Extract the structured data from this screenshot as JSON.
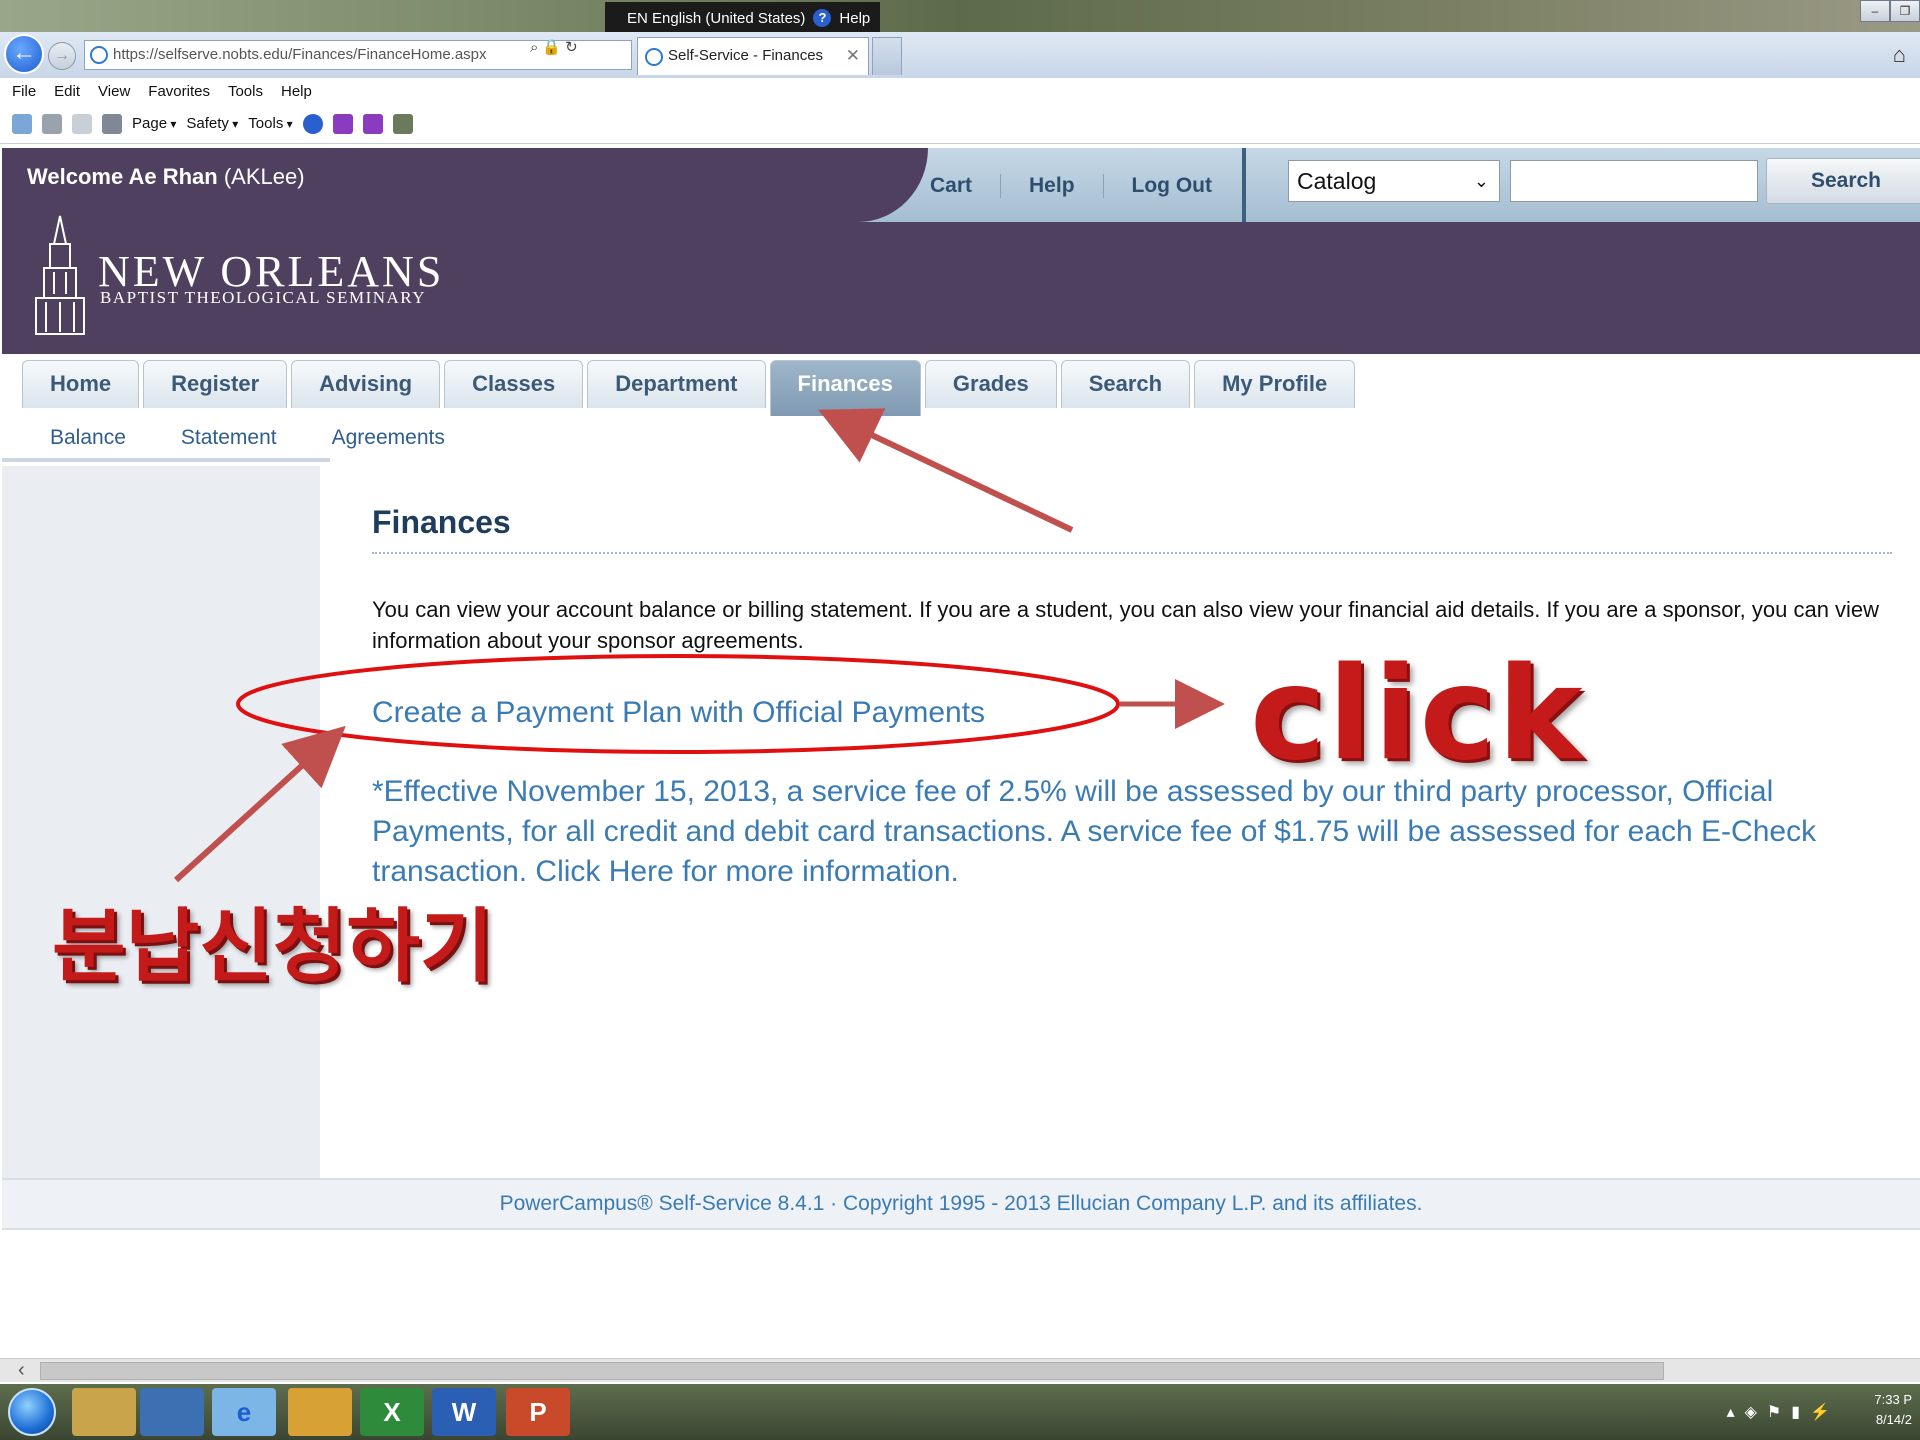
{
  "window": {
    "language_bar": "EN English (United States)",
    "language_help": "Help"
  },
  "browser": {
    "url": "https://selfserve.nobts.edu/Finances/FinanceHome.aspx",
    "tab_title": "Self-Service - Finances",
    "menu": [
      "File",
      "Edit",
      "View",
      "Favorites",
      "Tools",
      "Help"
    ],
    "command_bar": {
      "page": "Page",
      "safety": "Safety",
      "tools": "Tools"
    }
  },
  "header": {
    "welcome_prefix": "Welcome Ae Rhan",
    "welcome_user": "(AKLee)",
    "logo_line1": "NEW ORLEANS",
    "logo_line2": "BAPTIST THEOLOGICAL SEMINARY",
    "util_links": [
      "Cart",
      "Help",
      "Log Out"
    ],
    "catalog_select": "Catalog",
    "search_value": "",
    "search_button": "Search"
  },
  "tabs": [
    {
      "label": "Home",
      "active": false
    },
    {
      "label": "Register",
      "active": false
    },
    {
      "label": "Advising",
      "active": false
    },
    {
      "label": "Classes",
      "active": false
    },
    {
      "label": "Department",
      "active": false
    },
    {
      "label": "Finances",
      "active": true
    },
    {
      "label": "Grades",
      "active": false
    },
    {
      "label": "Search",
      "active": false
    },
    {
      "label": "My Profile",
      "active": false
    }
  ],
  "subnav": [
    "Balance",
    "Statement",
    "Agreements"
  ],
  "main": {
    "title": "Finances",
    "intro": "You can view your account balance or billing statement. If you are a student, you can also view your financial aid details. If you are a sponsor, you can view information about your sponsor agreements.",
    "payment_link": "Create a Payment Plan with Official Payments",
    "fee_notice": "*Effective November 15, 2013, a service fee of 2.5% will be assessed by our third party processor, Official Payments, for all credit and debit card transactions. A service fee of $1.75 will be assessed for each E-Check transaction. Click Here for more information."
  },
  "footer": "PowerCampus® Self-Service 8.4.1 · Copyright 1995 - 2013 Ellucian Company L.P. and its affiliates.",
  "annotations": {
    "click_label": "click",
    "korean_label": "분납신청하기",
    "color": "#c41a1a"
  },
  "taskbar": {
    "time": "7:33 P",
    "date": "8/14/2"
  },
  "colors": {
    "header_bg": "#4f405f",
    "link": "#3b7bb4",
    "active_tab": "#8aa3ba"
  }
}
